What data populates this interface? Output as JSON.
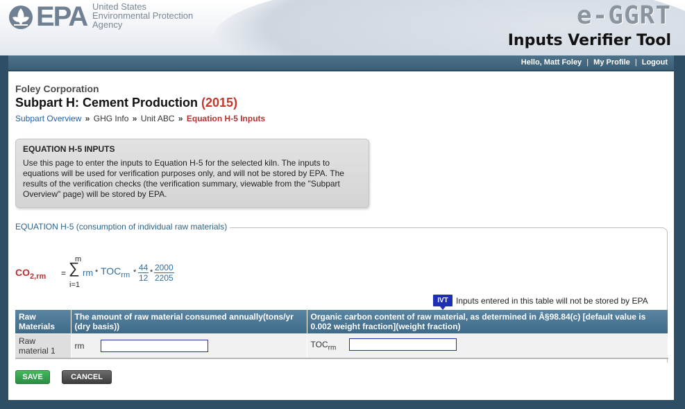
{
  "header": {
    "logo_text": "EPA",
    "agency_line1": "United States",
    "agency_line2": "Environmental Protection",
    "agency_line3": "Agency",
    "app_name": "e-GGRT",
    "tool_name": "Inputs Verifier Tool"
  },
  "user_nav": {
    "greeting": "Hello, Matt Foley",
    "separator": "|",
    "my_profile": "My Profile",
    "logout": "Logout"
  },
  "page": {
    "company": "Foley Corporation",
    "subpart_title": "Subpart H: Cement Production",
    "year": "(2015)",
    "breadcrumb": [
      {
        "label": "Subpart Overview",
        "link": true
      },
      {
        "label": "GHG Info",
        "link": false
      },
      {
        "label": "Unit ABC",
        "link": false
      },
      {
        "label": "Equation H-5 Inputs",
        "link": false,
        "current": true
      }
    ],
    "breadcrumb_sep": "»"
  },
  "infobox": {
    "title": "EQUATION H-5 INPUTS",
    "text": "Use this page to enter the inputs to Equation H-5 for the selected kiln. The inputs to equations will be used for verification purposes only, and will not be stored by EPA. The results of the verification checks (the verification summary, viewable from the \"Subpart Overview\" page) will be stored by EPA."
  },
  "equation": {
    "legend": "EQUATION H-5 (consumption of individual raw materials)",
    "lhs": "CO",
    "lhs_sub": "2,rm",
    "equals": "=",
    "sum_upper": "m",
    "sum_symbol": "∑",
    "sum_lower": "i=1",
    "term1": "rm",
    "mult": "*",
    "term2": "TOC",
    "term2_sub": "rm",
    "frac1_num": "44",
    "frac1_den": "12",
    "frac2_num": "2000",
    "frac2_den": "2205"
  },
  "ivt_notice": {
    "badge": "IVT",
    "text": "Inputs entered in this table will not be stored by EPA"
  },
  "table": {
    "headers": [
      "Raw Materials",
      "The amount of raw material consumed annually(tons/yr (dry basis))",
      "Organic carbon content of raw material, as determined in Â§98.84(c) [default value is 0.002 weight fraction](weight fraction)"
    ],
    "rows": [
      {
        "name": "Raw material 1",
        "rm_label": "rm",
        "rm_value": "",
        "toc_label": "TOC",
        "toc_label_sub": "rm",
        "toc_value": ""
      }
    ]
  },
  "buttons": {
    "save": "SAVE",
    "cancel": "CANCEL"
  },
  "colors": {
    "nav_bar": "#3c5f76",
    "table_header": "#4a7695",
    "accent_red": "#b8312f",
    "link_blue": "#1f5fa8",
    "save_green": "#33a04d",
    "ivt_blue": "#1f2fb4"
  }
}
